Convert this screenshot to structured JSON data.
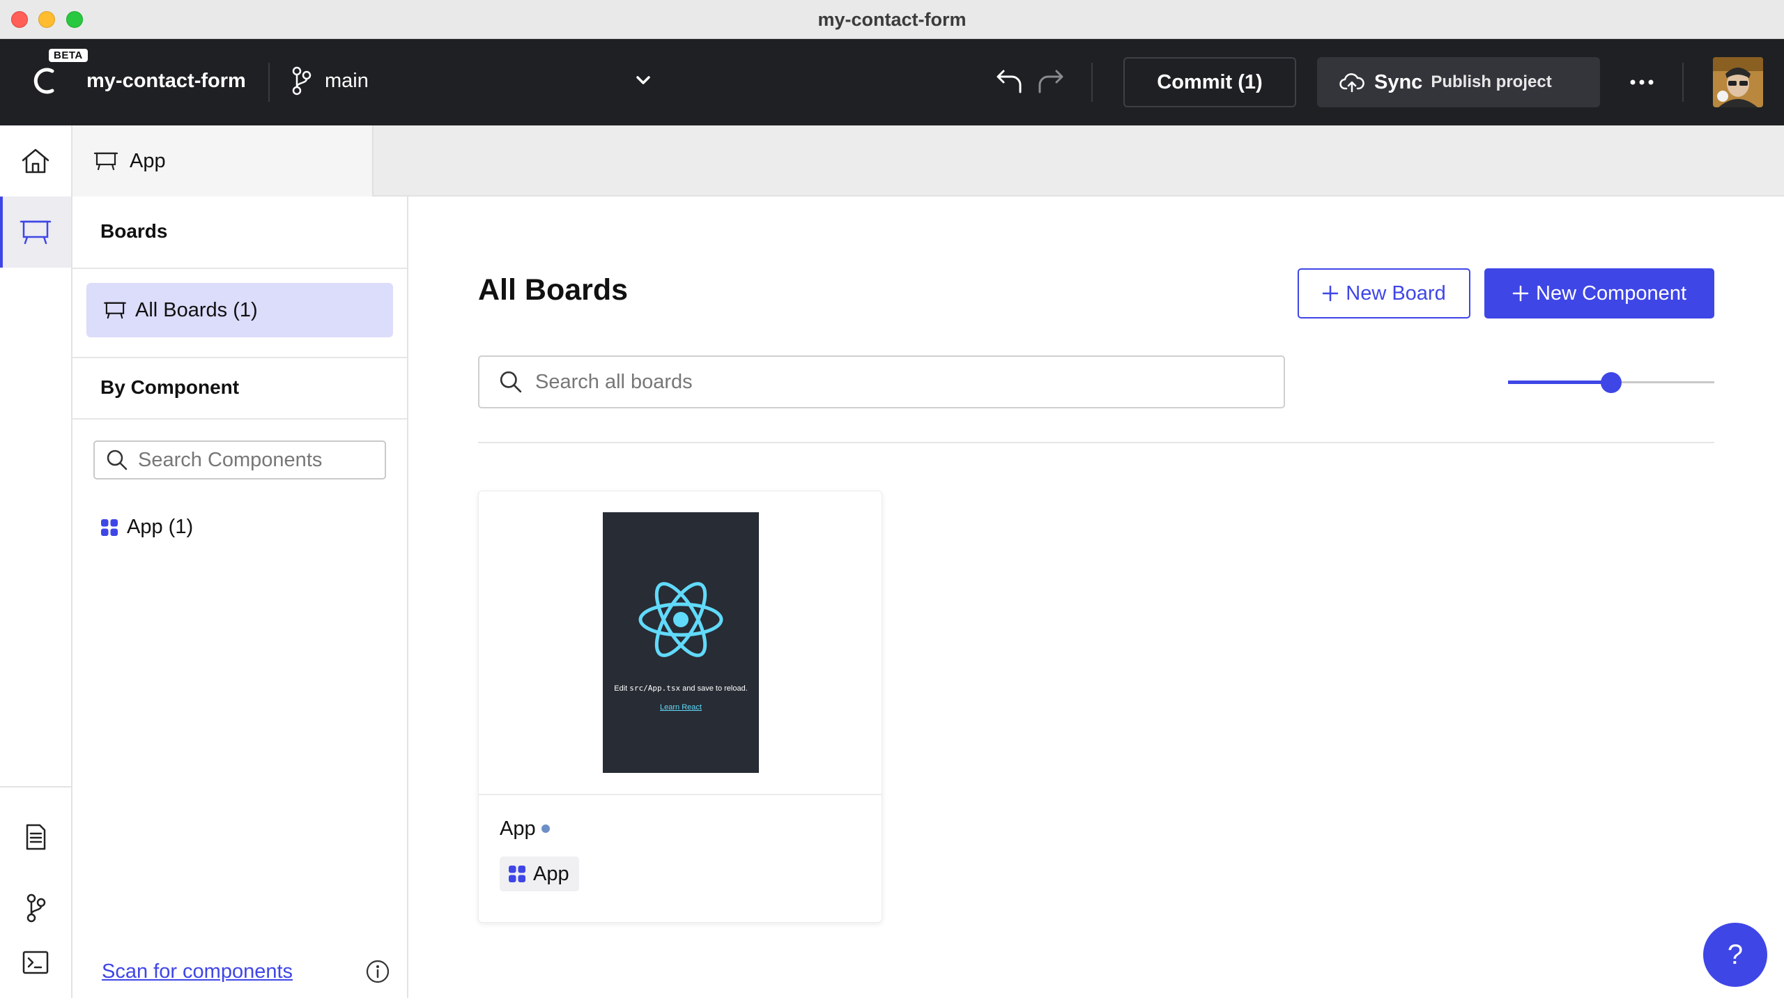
{
  "window": {
    "title": "my-contact-form"
  },
  "header": {
    "beta_badge": "BETA",
    "project_name": "my-contact-form",
    "branch": "main",
    "commit_label": "Commit (1)",
    "sync_label": "Sync",
    "sync_sublabel": "Publish project"
  },
  "rail": {
    "items": [
      "home-icon",
      "board-icon",
      "document-icon",
      "git-branch-icon",
      "terminal-icon"
    ],
    "active": "board-icon"
  },
  "tabs": [
    {
      "label": "App",
      "icon": "board-icon"
    }
  ],
  "sidebar": {
    "boards_heading": "Boards",
    "all_boards_label": "All Boards (1)",
    "by_component_heading": "By Component",
    "search_placeholder": "Search Components",
    "components": [
      {
        "label": "App (1)",
        "icon": "component-icon"
      }
    ],
    "scan_link": "Scan for components"
  },
  "main": {
    "title": "All Boards",
    "new_board_label": "New Board",
    "new_component_label": "New Component",
    "search_placeholder": "Search all boards",
    "zoom_slider_value": 0.5
  },
  "boards": [
    {
      "title": "App",
      "component_chip": "App",
      "preview": {
        "text_before": "Edit ",
        "code": "src/App.tsx",
        "text_after": " and save to reload.",
        "link": "Learn React"
      }
    }
  ],
  "help": {
    "label": "?"
  },
  "colors": {
    "accent": "#3f46e6",
    "header_bg": "#1f2023",
    "selected_bg": "#dcdcfb",
    "react_blue": "#61dafb"
  }
}
